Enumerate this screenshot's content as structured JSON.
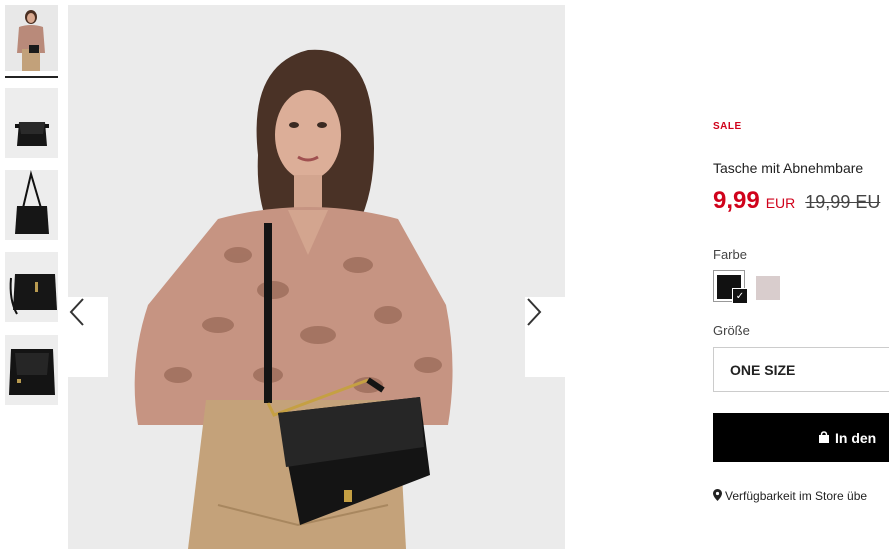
{
  "gallery": {
    "thumbnails": [
      {
        "icon": "model-photo-thumbnail"
      },
      {
        "icon": "bag-front-thumbnail"
      },
      {
        "icon": "bag-strap-thumbnail"
      },
      {
        "icon": "bag-side-thumbnail"
      },
      {
        "icon": "bag-open-thumbnail"
      }
    ],
    "prev_icon": "chevron-left-icon",
    "next_icon": "chevron-right-icon"
  },
  "product": {
    "badge": "SALE",
    "title": "Tasche mit Abnehmbare",
    "price_now": "9,99",
    "currency": "EUR",
    "price_old": "19,99 EU",
    "colors": {
      "sale_red": "#d0021b",
      "button_black": "#000000"
    }
  },
  "options": {
    "color_label": "Farbe",
    "color_swatches": [
      "#111111",
      "#d9cdcd"
    ],
    "size_label": "Größe",
    "size_value": "ONE SIZE"
  },
  "actions": {
    "cart_button": "In den",
    "cart_icon": "shopping-bag-icon",
    "store_link": "Verfügbarkeit im Store übe",
    "store_icon": "map-pin-icon"
  }
}
